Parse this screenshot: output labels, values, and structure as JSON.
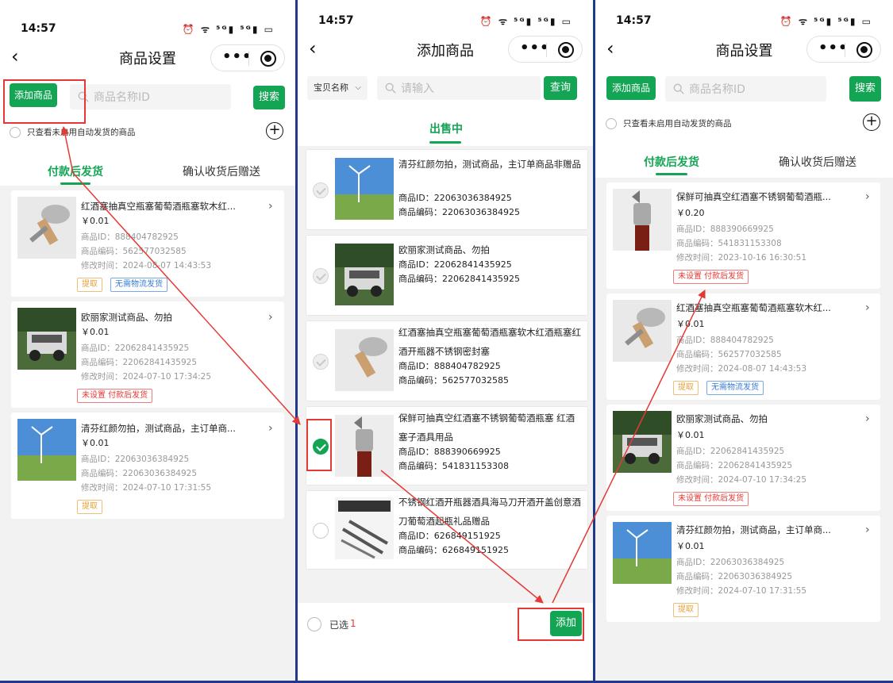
{
  "status": {
    "time": "14:57",
    "icons": "⏰ ᯤ ⁵ᴳ▮ ⁵ᴳ▮ ▭"
  },
  "nav": {
    "back": "‹",
    "p1_title": "商品设置",
    "p2_title": "添加商品",
    "p3_title": "商品设置"
  },
  "search": {
    "add_label": "添加商品",
    "placeholder": "商品名称ID",
    "search_label": "搜索",
    "p2_select": "宝贝名称",
    "p2_placeholder": "请输入",
    "p2_query": "查询"
  },
  "filter": {
    "text": "只查看未启用自动发货的商品",
    "plus": "+"
  },
  "tabs": {
    "after_pay": "付款后发货",
    "after_confirm": "确认收货后赠送",
    "on_sale": "出售中"
  },
  "labels": {
    "product_id": "商品ID：",
    "product_code": "商品编码：",
    "modified": "修改时间："
  },
  "products": {
    "wine_stopper": {
      "title": "红酒塞抽真空瓶塞葡萄酒瓶塞软木红...",
      "full_title": "红酒塞抽真空瓶塞葡萄酒瓶塞软木红酒瓶塞红酒开瓶器不锈钢密封塞",
      "price": "￥0.01",
      "id": "888404782925",
      "code": "562577032585",
      "time": "2024-08-07 14:43:53"
    },
    "europe": {
      "title": "欧丽家测试商品、勿拍",
      "price": "￥0.01",
      "id": "22062841435925",
      "code": "22062841435925",
      "time": "2024-07-10 17:34:25"
    },
    "qingfen": {
      "title": "清芬红颜勿拍，测试商品，主订单商...",
      "full_title": "清芬红颜勿拍，测试商品，主订单商品非赠品",
      "price": "￥0.01",
      "id": "22063036384925",
      "code": "22063036384925",
      "time": "2024-07-10 17:31:55"
    },
    "fresh_stopper": {
      "title": "保鲜可抽真空红酒塞不锈钢葡萄酒瓶...",
      "full_title": "保鲜可抽真空红酒塞不锈钢葡萄酒瓶塞 红酒塞子酒具用品",
      "price": "￥0.20",
      "id": "888390669925",
      "code": "541831153308",
      "time": "2023-10-16 16:30:51"
    },
    "opener": {
      "full_title": "不锈钢红酒开瓶器酒具海马刀开酒开盖创意酒刀葡萄酒起瓶礼品赠品",
      "id": "626849151925",
      "code": "626849151925"
    }
  },
  "tags": {
    "extract": "提取",
    "no_logistics": "无需物流发货",
    "not_set": "未设置 付款后发货"
  },
  "bottom": {
    "selected": "已选",
    "count": "1",
    "add": "添加"
  },
  "colors": {
    "brand_green": "#13a454",
    "annotation_red": "#e53935",
    "divider_blue": "#1f3a8a"
  }
}
